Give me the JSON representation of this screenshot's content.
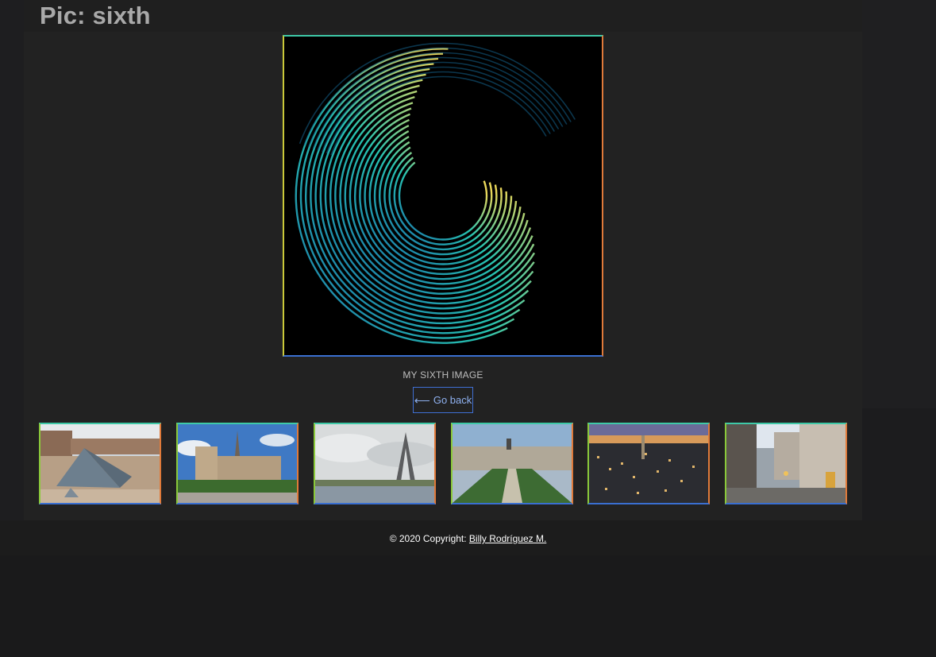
{
  "header": {
    "title": "Pic: sixth"
  },
  "main_image": {
    "icon": "spiral-artwork-image"
  },
  "caption": "MY SIXTH IMAGE",
  "go_back": {
    "arrow": "⟵",
    "label": "Go back"
  },
  "thumbnails": [
    {
      "icon": "louvre-pyramid-thumbnail"
    },
    {
      "icon": "notre-dame-thumbnail"
    },
    {
      "icon": "eiffel-tower-thumbnail"
    },
    {
      "icon": "champ-de-mars-aerial-thumbnail"
    },
    {
      "icon": "city-skyline-night-thumbnail"
    },
    {
      "icon": "paris-street-thumbnail"
    }
  ],
  "footer": {
    "copyright": "© 2020 Copyright: ",
    "author": "Billy Rodríguez M."
  },
  "colors": {
    "frame_top": "#3ec9a7",
    "frame_right": "#e07a3a",
    "frame_bottom": "#3a6fd1",
    "frame_left": "#c9c83a",
    "button_border": "#3f6fd3"
  }
}
